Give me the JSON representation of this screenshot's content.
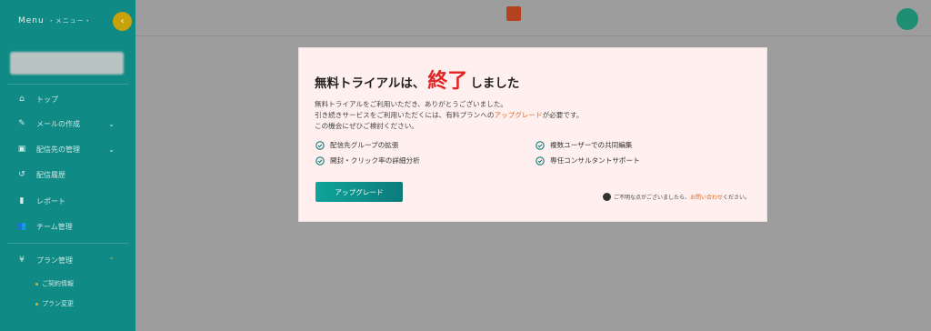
{
  "sidebar": {
    "menu_label": "Menu",
    "menu_sub": "・メニュー・",
    "collapse_icon": "‹",
    "search_placeholder": "",
    "items": [
      {
        "label": "トップ",
        "icon": "⌂"
      },
      {
        "label": "メールの作成",
        "icon": "✎",
        "chevron": "⌄"
      },
      {
        "label": "配信先の管理",
        "icon": "▣",
        "chevron": "⌄"
      },
      {
        "label": "配信履歴",
        "icon": "↺"
      },
      {
        "label": "レポート",
        "icon": "▮"
      },
      {
        "label": "チーム管理",
        "icon": "👥"
      },
      {
        "label": "プラン管理",
        "icon": "¥",
        "chevron": "⌃"
      }
    ],
    "sub_items": [
      {
        "label": "ご契約情報"
      },
      {
        "label": "プラン変更"
      }
    ]
  },
  "modal": {
    "title_before": "無料トライアルは、",
    "title_accent": "終了",
    "title_after": "しました",
    "desc_line1": "無料トライアルをご利用いただき、ありがとうございました。",
    "desc_line2_before": "引き続きサービスをご利用いただくには、有料プランへの",
    "desc_line2_link": "アップグレード",
    "desc_line2_after": "が必要です。",
    "desc_line3": "この機会にぜひご検討ください。",
    "features": [
      "配信先グループの拡張",
      "開封・クリック率の詳細分析",
      "複数ユーザーでの共同編集",
      "専任コンサルタントサポート"
    ],
    "upgrade_button": "アップグレード",
    "help_before": "ご不明な点がございましたら、",
    "help_link": "お問い合わせ",
    "help_after": "ください。"
  },
  "colors": {
    "sidebar_bg": "#0f8a84",
    "accent_red": "#e02424",
    "link_orange": "#e0671f",
    "check_teal": "#0c7b7a"
  }
}
